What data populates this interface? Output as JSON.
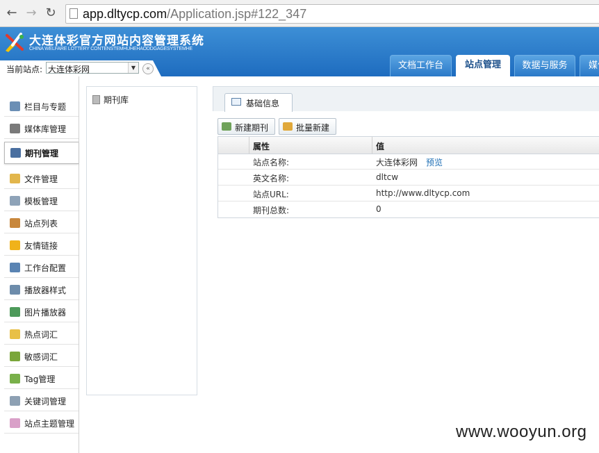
{
  "browser": {
    "url_host": "app.dltycp.com",
    "url_path": "/Application.jsp#122_347"
  },
  "header": {
    "title": "大连体彩官方网站内容管理系统",
    "subtitle": "CHINA WELFARE LOTTERY CONTENSTEMHUHEHAODDGAGESYSTEMHE",
    "site_label": "当前站点:",
    "site_value": "大连体彩网",
    "collapse_symbol": "«",
    "tabs": [
      {
        "label": "文档工作台",
        "active": false
      },
      {
        "label": "站点管理",
        "active": true
      },
      {
        "label": "数据与服务",
        "active": false
      },
      {
        "label": "媒体",
        "active": false
      }
    ]
  },
  "sidebar": {
    "items": [
      {
        "label": "栏目与专题",
        "icon": "monitor-icon",
        "color": "#6b8fb5"
      },
      {
        "label": "媒体库管理",
        "icon": "speaker-icon",
        "color": "#7a7a7a"
      },
      {
        "label": "期刊管理",
        "icon": "journal-icon",
        "color": "#4a6fa0",
        "active": true
      },
      {
        "label": "文件管理",
        "icon": "folder-icon",
        "color": "#e2b64c"
      },
      {
        "label": "模板管理",
        "icon": "template-icon",
        "color": "#8ea3b8"
      },
      {
        "label": "站点列表",
        "icon": "house-icon",
        "color": "#c8873c"
      },
      {
        "label": "友情链接",
        "icon": "lightning-icon",
        "color": "#f0b21a"
      },
      {
        "label": "工作台配置",
        "icon": "workbench-icon",
        "color": "#5a84b3"
      },
      {
        "label": "播放器样式",
        "icon": "player-icon",
        "color": "#6d8cab"
      },
      {
        "label": "图片播放器",
        "icon": "image-player-icon",
        "color": "#4d9a5a"
      },
      {
        "label": "热点词汇",
        "icon": "hotword-icon",
        "color": "#e8c047"
      },
      {
        "label": "敏感词汇",
        "icon": "sensitive-icon",
        "color": "#7aa63a"
      },
      {
        "label": "Tag管理",
        "icon": "puzzle-icon",
        "color": "#79b04a"
      },
      {
        "label": "关键词管理",
        "icon": "keyword-icon",
        "color": "#8da0b3"
      },
      {
        "label": "站点主题管理",
        "icon": "tag-icon",
        "color": "#d9a0c8"
      }
    ]
  },
  "tree": {
    "root_label": "期刊库"
  },
  "main": {
    "tab_label": "基础信息",
    "toolbar": {
      "new_label": "新建期刊",
      "batch_label": "批量新建"
    },
    "grid": {
      "headers": {
        "attribute": "属性",
        "value": "值"
      },
      "rows": [
        {
          "attr": "站点名称:",
          "value": "大连体彩网",
          "link": "预览"
        },
        {
          "attr": "英文名称:",
          "value": "dltcw"
        },
        {
          "attr": "站点URL:",
          "value": "http://www.dltycp.com"
        },
        {
          "attr": "期刊总数:",
          "value": "0"
        }
      ]
    }
  },
  "watermark": "www.wooyun.org"
}
